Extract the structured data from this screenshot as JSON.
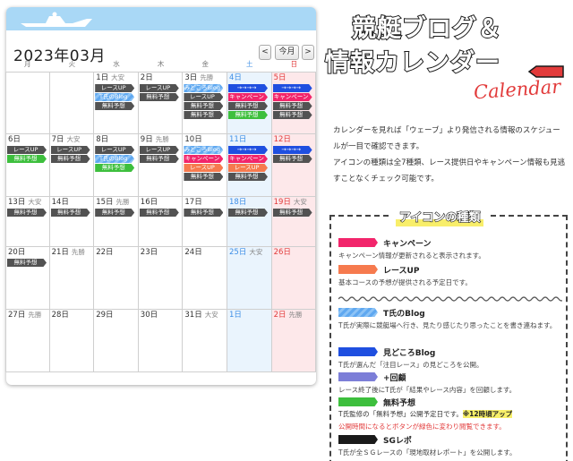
{
  "calendar": {
    "title": "2023年03月",
    "nav": {
      "prev": "<",
      "this_month": "今月",
      "next": ">"
    },
    "weekdays": [
      "月",
      "火",
      "水",
      "木",
      "金",
      "土",
      "日"
    ],
    "weeks": [
      [
        {
          "day": "",
          "rokuyo": "",
          "tags": []
        },
        {
          "day": "",
          "rokuyo": "",
          "tags": []
        },
        {
          "day": "1日",
          "rokuyo": "大安",
          "tags": [
            {
              "t": "gray",
              "label": "レースUP"
            },
            {
              "t": "blog",
              "label": "T氏のBlog"
            },
            {
              "t": "gray",
              "label": "無料予想"
            }
          ]
        },
        {
          "day": "2日",
          "rokuyo": "",
          "tags": [
            {
              "t": "gray",
              "label": "レースUP"
            },
            {
              "t": "gray",
              "label": "無料予想"
            }
          ]
        },
        {
          "day": "3日",
          "rokuyo": "先勝",
          "tags": [
            {
              "t": "blog",
              "label": "みどころBlog"
            },
            {
              "t": "gray",
              "label": "レースUP"
            },
            {
              "t": "gray",
              "label": "無料予想"
            },
            {
              "t": "gray",
              "label": "無料予想"
            }
          ]
        },
        {
          "day": "4日",
          "rokuyo": "",
          "tags": [
            {
              "t": "midokoro",
              "label": "→→→→"
            },
            {
              "t": "camp",
              "label": "キャンペーン"
            },
            {
              "t": "gray",
              "label": "無料予想"
            },
            {
              "t": "green",
              "label": "無料予想"
            }
          ]
        },
        {
          "day": "5日",
          "rokuyo": "",
          "tags": [
            {
              "t": "midokoro",
              "label": "→→→→"
            },
            {
              "t": "camp",
              "label": "キャンペーン"
            },
            {
              "t": "gray",
              "label": "無料予想"
            },
            {
              "t": "gray",
              "label": "無料予想"
            }
          ]
        }
      ],
      [
        {
          "day": "6日",
          "rokuyo": "",
          "tags": [
            {
              "t": "gray",
              "label": "レースUP"
            },
            {
              "t": "green",
              "label": "無料予想"
            }
          ]
        },
        {
          "day": "7日",
          "rokuyo": "大安",
          "tags": [
            {
              "t": "gray",
              "label": "レースUP"
            },
            {
              "t": "gray",
              "label": "無料予想"
            }
          ]
        },
        {
          "day": "8日",
          "rokuyo": "",
          "tags": [
            {
              "t": "gray",
              "label": "レースUP"
            },
            {
              "t": "blog",
              "label": "T氏のBlog"
            },
            {
              "t": "green",
              "label": "無料予想"
            }
          ]
        },
        {
          "day": "9日",
          "rokuyo": "先勝",
          "tags": [
            {
              "t": "gray",
              "label": "レースUP"
            },
            {
              "t": "gray",
              "label": "無料予想"
            }
          ]
        },
        {
          "day": "10日",
          "rokuyo": "",
          "tags": [
            {
              "t": "blog",
              "label": "みどころBlog"
            },
            {
              "t": "camp",
              "label": "キャンペーン"
            },
            {
              "t": "race",
              "label": "レースUP"
            },
            {
              "t": "gray",
              "label": "無料予想"
            }
          ]
        },
        {
          "day": "11日",
          "rokuyo": "",
          "tags": [
            {
              "t": "midokoro",
              "label": "→→→→"
            },
            {
              "t": "camp",
              "label": "キャンペーン"
            },
            {
              "t": "race",
              "label": "レースUP"
            },
            {
              "t": "gray",
              "label": "無料予想"
            }
          ]
        },
        {
          "day": "12日",
          "rokuyo": "",
          "tags": [
            {
              "t": "midokoro",
              "label": "→→→→"
            },
            {
              "t": "gray",
              "label": "無料予想"
            }
          ]
        }
      ],
      [
        {
          "day": "13日",
          "rokuyo": "大安",
          "tags": [
            {
              "t": "gray",
              "label": "無料予想"
            }
          ]
        },
        {
          "day": "14日",
          "rokuyo": "",
          "tags": [
            {
              "t": "gray",
              "label": "無料予想"
            }
          ]
        },
        {
          "day": "15日",
          "rokuyo": "先勝",
          "tags": [
            {
              "t": "gray",
              "label": "無料予想"
            }
          ]
        },
        {
          "day": "16日",
          "rokuyo": "",
          "tags": [
            {
              "t": "gray",
              "label": "無料予想"
            }
          ]
        },
        {
          "day": "17日",
          "rokuyo": "",
          "tags": [
            {
              "t": "gray",
              "label": "無料予想"
            }
          ]
        },
        {
          "day": "18日",
          "rokuyo": "",
          "tags": [
            {
              "t": "gray",
              "label": "無料予想"
            }
          ]
        },
        {
          "day": "19日",
          "rokuyo": "大安",
          "tags": [
            {
              "t": "gray",
              "label": "無料予想"
            }
          ]
        }
      ],
      [
        {
          "day": "20日",
          "rokuyo": "",
          "tags": [
            {
              "t": "gray",
              "label": "無料予想"
            }
          ]
        },
        {
          "day": "21日",
          "rokuyo": "先勝",
          "tags": []
        },
        {
          "day": "22日",
          "rokuyo": "",
          "tags": []
        },
        {
          "day": "23日",
          "rokuyo": "",
          "tags": []
        },
        {
          "day": "24日",
          "rokuyo": "",
          "tags": []
        },
        {
          "day": "25日",
          "rokuyo": "大安",
          "tags": []
        },
        {
          "day": "26日",
          "rokuyo": "",
          "tags": []
        }
      ],
      [
        {
          "day": "27日",
          "rokuyo": "先勝",
          "tags": []
        },
        {
          "day": "28日",
          "rokuyo": "",
          "tags": []
        },
        {
          "day": "29日",
          "rokuyo": "",
          "tags": []
        },
        {
          "day": "30日",
          "rokuyo": "",
          "tags": []
        },
        {
          "day": "31日",
          "rokuyo": "大安",
          "tags": []
        },
        {
          "day": "1日",
          "rokuyo": "",
          "tags": []
        },
        {
          "day": "2日",
          "rokuyo": "先勝",
          "tags": []
        }
      ]
    ]
  },
  "logo": {
    "line1": "競艇ブログ＆",
    "line2": "情報カレンダー",
    "script": "Calendar"
  },
  "intro": {
    "p1": "カレンダーを見れば「ウェーブ」より発信される情報のスケジュールが一目で確認できます。",
    "p2": "アイコンの種類は全7種類、レース提供日やキャンペーン情報も見逃すことなくチェック可能です。"
  },
  "legend": {
    "title": "アイコンの種類",
    "items": [
      {
        "name": "キャンペーン",
        "desc": "キャンペーン情報が更新されると表示されます。",
        "color": "#f2256b"
      },
      {
        "name": "レースUP",
        "desc": "基本コースの予想が提供される予定日です。",
        "color": "#f67a4e"
      },
      {
        "name": "T氏のBlog",
        "desc": "T氏が実際に競艇場へ行き、見たり感じたり思ったことを書き連ねます。",
        "color": "#5fa8f0"
      },
      {
        "name": "見どころBlog",
        "desc": "T氏が選んだ「注目レース」の見どころを公開。",
        "color": "#1f4fe0"
      },
      {
        "name": "+回顧",
        "desc": "レース終了後にT氏が「結果やレース内容」を回顧します。",
        "color": "#7c7ed8"
      },
      {
        "name": "無料予想",
        "desc": "T氏監修の「無料予想」公開予定日です。",
        "highlight": "※12時頃アップ",
        "note": "公開時間になるとボタンが緑色に変わり閲覧できます。",
        "color": "#3dbf3d"
      },
      {
        "name": "SGレポ",
        "desc": "T氏が全ＳＧレースの「現地取材レポート」を公開します。",
        "color": "#1a1a1a"
      }
    ]
  }
}
